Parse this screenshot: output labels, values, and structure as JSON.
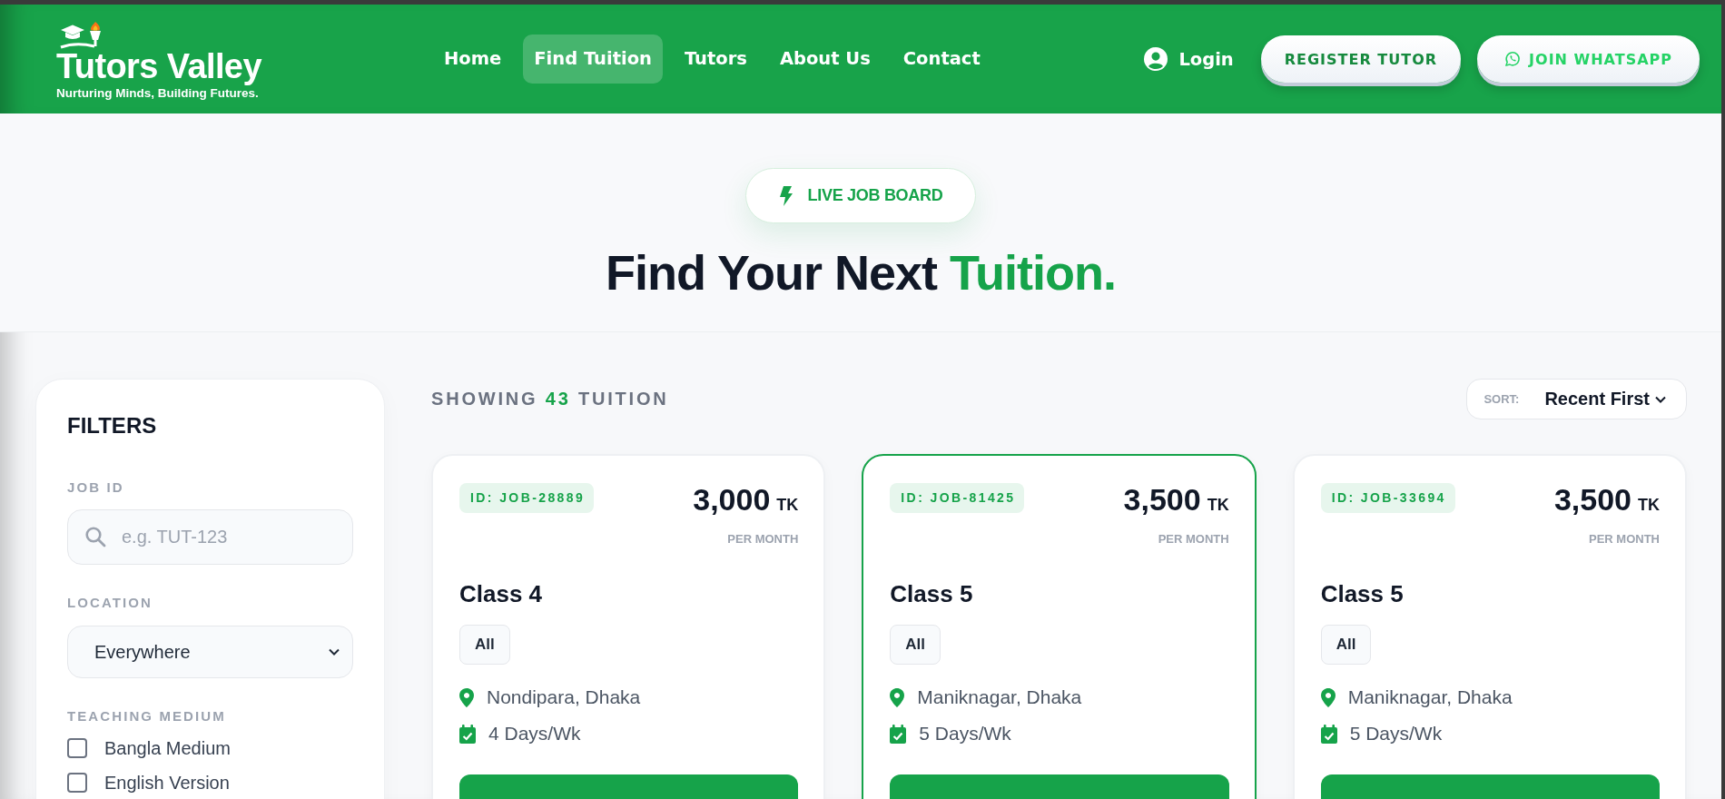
{
  "header": {
    "logo": {
      "name": "Tutors Valley",
      "tagline": "Nurturing Minds, Building Futures."
    },
    "nav": [
      {
        "label": "Home",
        "selected": false
      },
      {
        "label": "Find Tuition",
        "selected": true
      },
      {
        "label": "Tutors",
        "selected": false
      },
      {
        "label": "About Us",
        "selected": false
      },
      {
        "label": "Contact",
        "selected": false
      }
    ],
    "login": "Login",
    "buttons": [
      {
        "label": "REGISTER TUTOR",
        "kind": "register"
      },
      {
        "label": "JOIN WHATSAPP",
        "kind": "whatsapp"
      }
    ]
  },
  "hero": {
    "badge": "LIVE JOB BOARD",
    "title": "Find Your Next",
    "title_highlight": "Tuition."
  },
  "filters": {
    "title": "FILTERS",
    "job_id": {
      "label": "JOB ID",
      "placeholder": "e.g. TUT-123"
    },
    "location": {
      "label": "LOCATION",
      "value": "Everywhere"
    },
    "teaching_medium": {
      "label": "TEACHING MEDIUM",
      "options": [
        {
          "label": "Bangla Medium",
          "checked": false
        },
        {
          "label": "English Version",
          "checked": false
        }
      ]
    }
  },
  "results": {
    "count_prefix": "SHOWING",
    "count": "43",
    "count_suffix": "TUITION",
    "sort": {
      "label": "SORT:",
      "value": "Recent First"
    }
  },
  "cards": [
    {
      "id": "ID: JOB-28889",
      "price": "3,000",
      "currency": "TK",
      "period": "PER MONTH",
      "class": "Class 4",
      "tags": [
        "All"
      ],
      "location": "Nondipara, Dhaka",
      "schedule": "4 Days/Wk",
      "selected": false
    },
    {
      "id": "ID: JOB-81425",
      "price": "3,500",
      "currency": "TK",
      "period": "PER MONTH",
      "class": "Class 5",
      "tags": [
        "All"
      ],
      "location": "Maniknagar, Dhaka",
      "schedule": "5 Days/Wk",
      "selected": true
    },
    {
      "id": "ID: JOB-33694",
      "price": "3,500",
      "currency": "TK",
      "period": "PER MONTH",
      "class": "Class 5",
      "tags": [
        "All"
      ],
      "location": "Maniknagar, Dhaka",
      "schedule": "5 Days/Wk",
      "selected": false
    }
  ]
}
